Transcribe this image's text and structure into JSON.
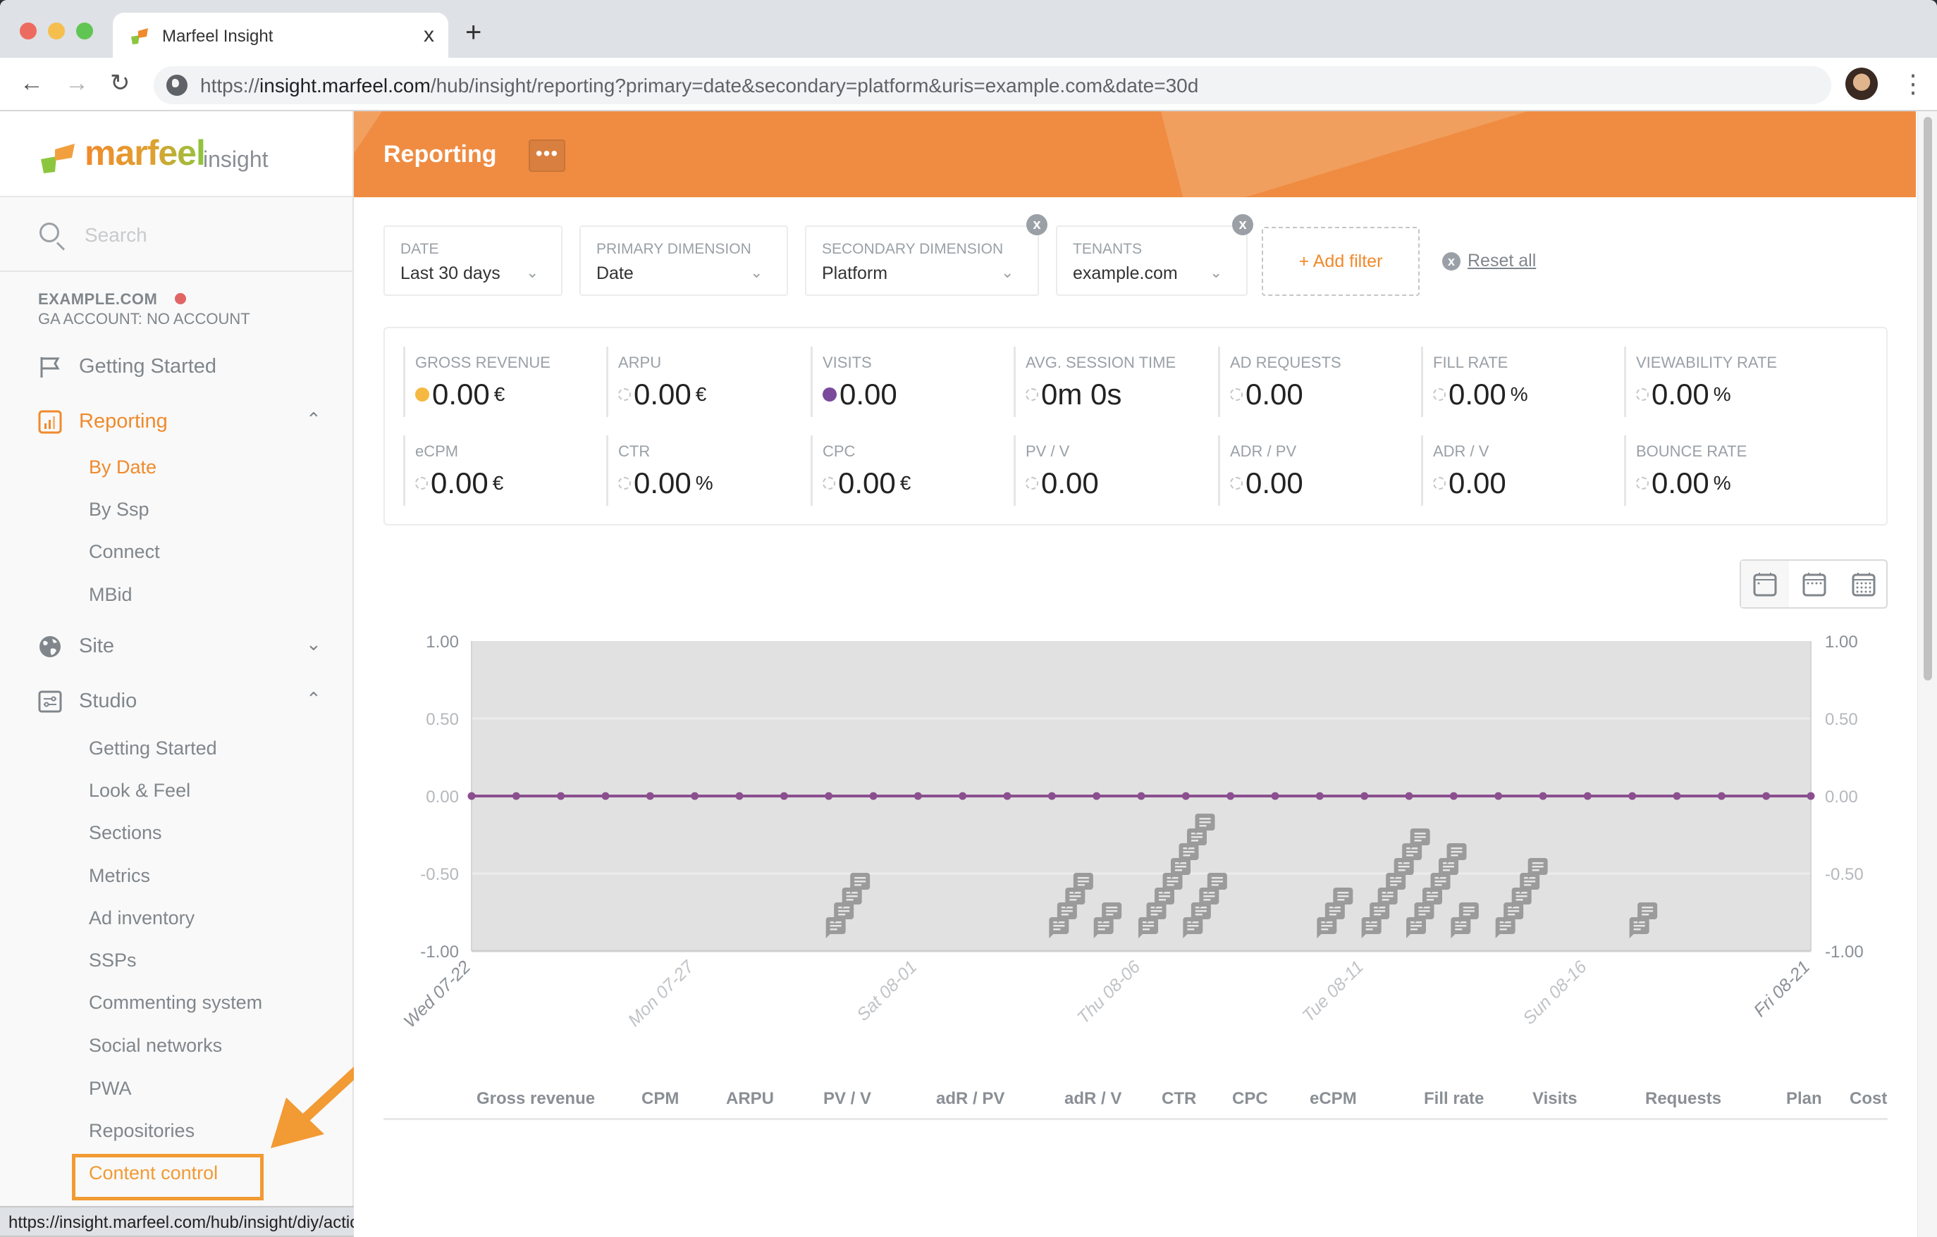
{
  "browser": {
    "tab_title": "Marfeel Insight",
    "tab_close": "x",
    "new_tab": "+",
    "url_prefix": "https://",
    "url_host": "insight.marfeel.com",
    "url_path": "/hub/insight/reporting?primary=date&secondary=platform&uris=example.com&date=30d",
    "status_url": "https://insight.marfeel.com/hub/insight/diy/actions"
  },
  "sidebar": {
    "logo_word": "marfeel",
    "logo_sub": "insight",
    "search_placeholder": "Search",
    "account_name": "EXAMPLE.COM",
    "account_status_color": "#e06666",
    "ga_account": "GA ACCOUNT: NO ACCOUNT",
    "items": [
      {
        "label": "Getting Started",
        "icon": "flag-icon"
      },
      {
        "label": "Reporting",
        "icon": "bar-chart-icon",
        "expanded": true,
        "active": true
      },
      {
        "label": "Site",
        "icon": "globe-icon",
        "expanded": false
      },
      {
        "label": "Studio",
        "icon": "sliders-icon",
        "expanded": true
      }
    ],
    "reporting_sub": [
      "By Date",
      "By Ssp",
      "Connect",
      "MBid"
    ],
    "reporting_active": "By Date",
    "studio_sub": [
      "Getting Started",
      "Look & Feel",
      "Sections",
      "Metrics",
      "Ad inventory",
      "SSPs",
      "Commenting system",
      "Social networks",
      "PWA",
      "Repositories",
      "Content control"
    ],
    "highlighted": "Content control"
  },
  "header": {
    "title": "Reporting",
    "more_label": "•••",
    "accent": "#ef8c42"
  },
  "filters": {
    "date": {
      "label": "DATE",
      "value": "Last 30 days"
    },
    "primary": {
      "label": "PRIMARY DIMENSION",
      "value": "Date"
    },
    "secondary": {
      "label": "SECONDARY DIMENSION",
      "value": "Platform"
    },
    "tenants": {
      "label": "TENANTS",
      "value": "example.com"
    },
    "add_filter": "+ Add filter",
    "reset_all": "Reset all",
    "remove_label": "x"
  },
  "kpis": [
    {
      "label": "GROSS REVENUE",
      "value": "0.00",
      "unit": "€",
      "dot": "#f5b942",
      "selected": true
    },
    {
      "label": "ARPU",
      "value": "0.00",
      "unit": "€",
      "dot": null
    },
    {
      "label": "VISITS",
      "value": "0.00",
      "unit": "",
      "dot": "#7b4a9b",
      "selected": true
    },
    {
      "label": "AVG. SESSION TIME",
      "value": "0m 0s",
      "unit": "",
      "dot": null
    },
    {
      "label": "AD REQUESTS",
      "value": "0.00",
      "unit": "",
      "dot": null
    },
    {
      "label": "FILL RATE",
      "value": "0.00",
      "unit": "%",
      "dot": null
    },
    {
      "label": "VIEWABILITY RATE",
      "value": "0.00",
      "unit": "%",
      "dot": null
    },
    {
      "label": "eCPM",
      "value": "0.00",
      "unit": "€",
      "dot": null
    },
    {
      "label": "CTR",
      "value": "0.00",
      "unit": "%",
      "dot": null
    },
    {
      "label": "CPC",
      "value": "0.00",
      "unit": "€",
      "dot": null
    },
    {
      "label": "PV / V",
      "value": "0.00",
      "unit": "",
      "dot": null
    },
    {
      "label": "ADR / PV",
      "value": "0.00",
      "unit": "",
      "dot": null
    },
    {
      "label": "ADR / V",
      "value": "0.00",
      "unit": "",
      "dot": null
    },
    {
      "label": "BOUNCE RATE",
      "value": "0.00",
      "unit": "%",
      "dot": null
    }
  ],
  "period_toggle": [
    "day-view",
    "week-view",
    "month-view"
  ],
  "chart_data": {
    "type": "line",
    "title": "",
    "xlabel": "",
    "ylabel": "",
    "ylim": [
      -1,
      1
    ],
    "y_ticks": [
      "1.00",
      "0.50",
      "0.00",
      "-0.50",
      "-1.00"
    ],
    "y2_ticks": [
      "1.00",
      "0.50",
      "0.00",
      "-0.50",
      "-1.00"
    ],
    "grid": true,
    "x": [
      "07-22",
      "07-23",
      "07-24",
      "07-25",
      "07-26",
      "07-27",
      "07-28",
      "07-29",
      "07-30",
      "07-31",
      "08-01",
      "08-02",
      "08-03",
      "08-04",
      "08-05",
      "08-06",
      "08-07",
      "08-08",
      "08-09",
      "08-10",
      "08-11",
      "08-12",
      "08-13",
      "08-14",
      "08-15",
      "08-16",
      "08-17",
      "08-18",
      "08-19",
      "08-20",
      "08-21"
    ],
    "x_tick_labels": [
      {
        "index": 0,
        "label": "Wed 07-22"
      },
      {
        "index": 5,
        "label": "Mon 07-27"
      },
      {
        "index": 10,
        "label": "Sat 08-01"
      },
      {
        "index": 15,
        "label": "Thu 08-06"
      },
      {
        "index": 20,
        "label": "Tue 08-11"
      },
      {
        "index": 25,
        "label": "Sun 08-16"
      },
      {
        "index": 30,
        "label": "Fri 08-21"
      }
    ],
    "series": [
      {
        "name": "Visits",
        "color": "#8b4f8f",
        "values": [
          0,
          0,
          0,
          0,
          0,
          0,
          0,
          0,
          0,
          0,
          0,
          0,
          0,
          0,
          0,
          0,
          0,
          0,
          0,
          0,
          0,
          0,
          0,
          0,
          0,
          0,
          0,
          0,
          0,
          0,
          0
        ]
      }
    ],
    "annotations": [
      {
        "index": 8,
        "count": 4
      },
      {
        "index": 13,
        "count": 4
      },
      {
        "index": 14,
        "count": 2
      },
      {
        "index": 15,
        "count": 8
      },
      {
        "index": 16,
        "count": 4
      },
      {
        "index": 19,
        "count": 3
      },
      {
        "index": 20,
        "count": 7
      },
      {
        "index": 21,
        "count": 6
      },
      {
        "index": 22,
        "count": 2
      },
      {
        "index": 23,
        "count": 5
      },
      {
        "index": 26,
        "count": 2
      }
    ],
    "plot_bg": "#e1e1e1"
  },
  "table": {
    "columns": [
      "Gross revenue",
      "CPM",
      "ARPU",
      "PV / V",
      "adR / PV",
      "adR / V",
      "CTR",
      "CPC",
      "eCPM",
      "Fill rate",
      "Visits",
      "Requests",
      "Plan",
      "Cost"
    ]
  }
}
